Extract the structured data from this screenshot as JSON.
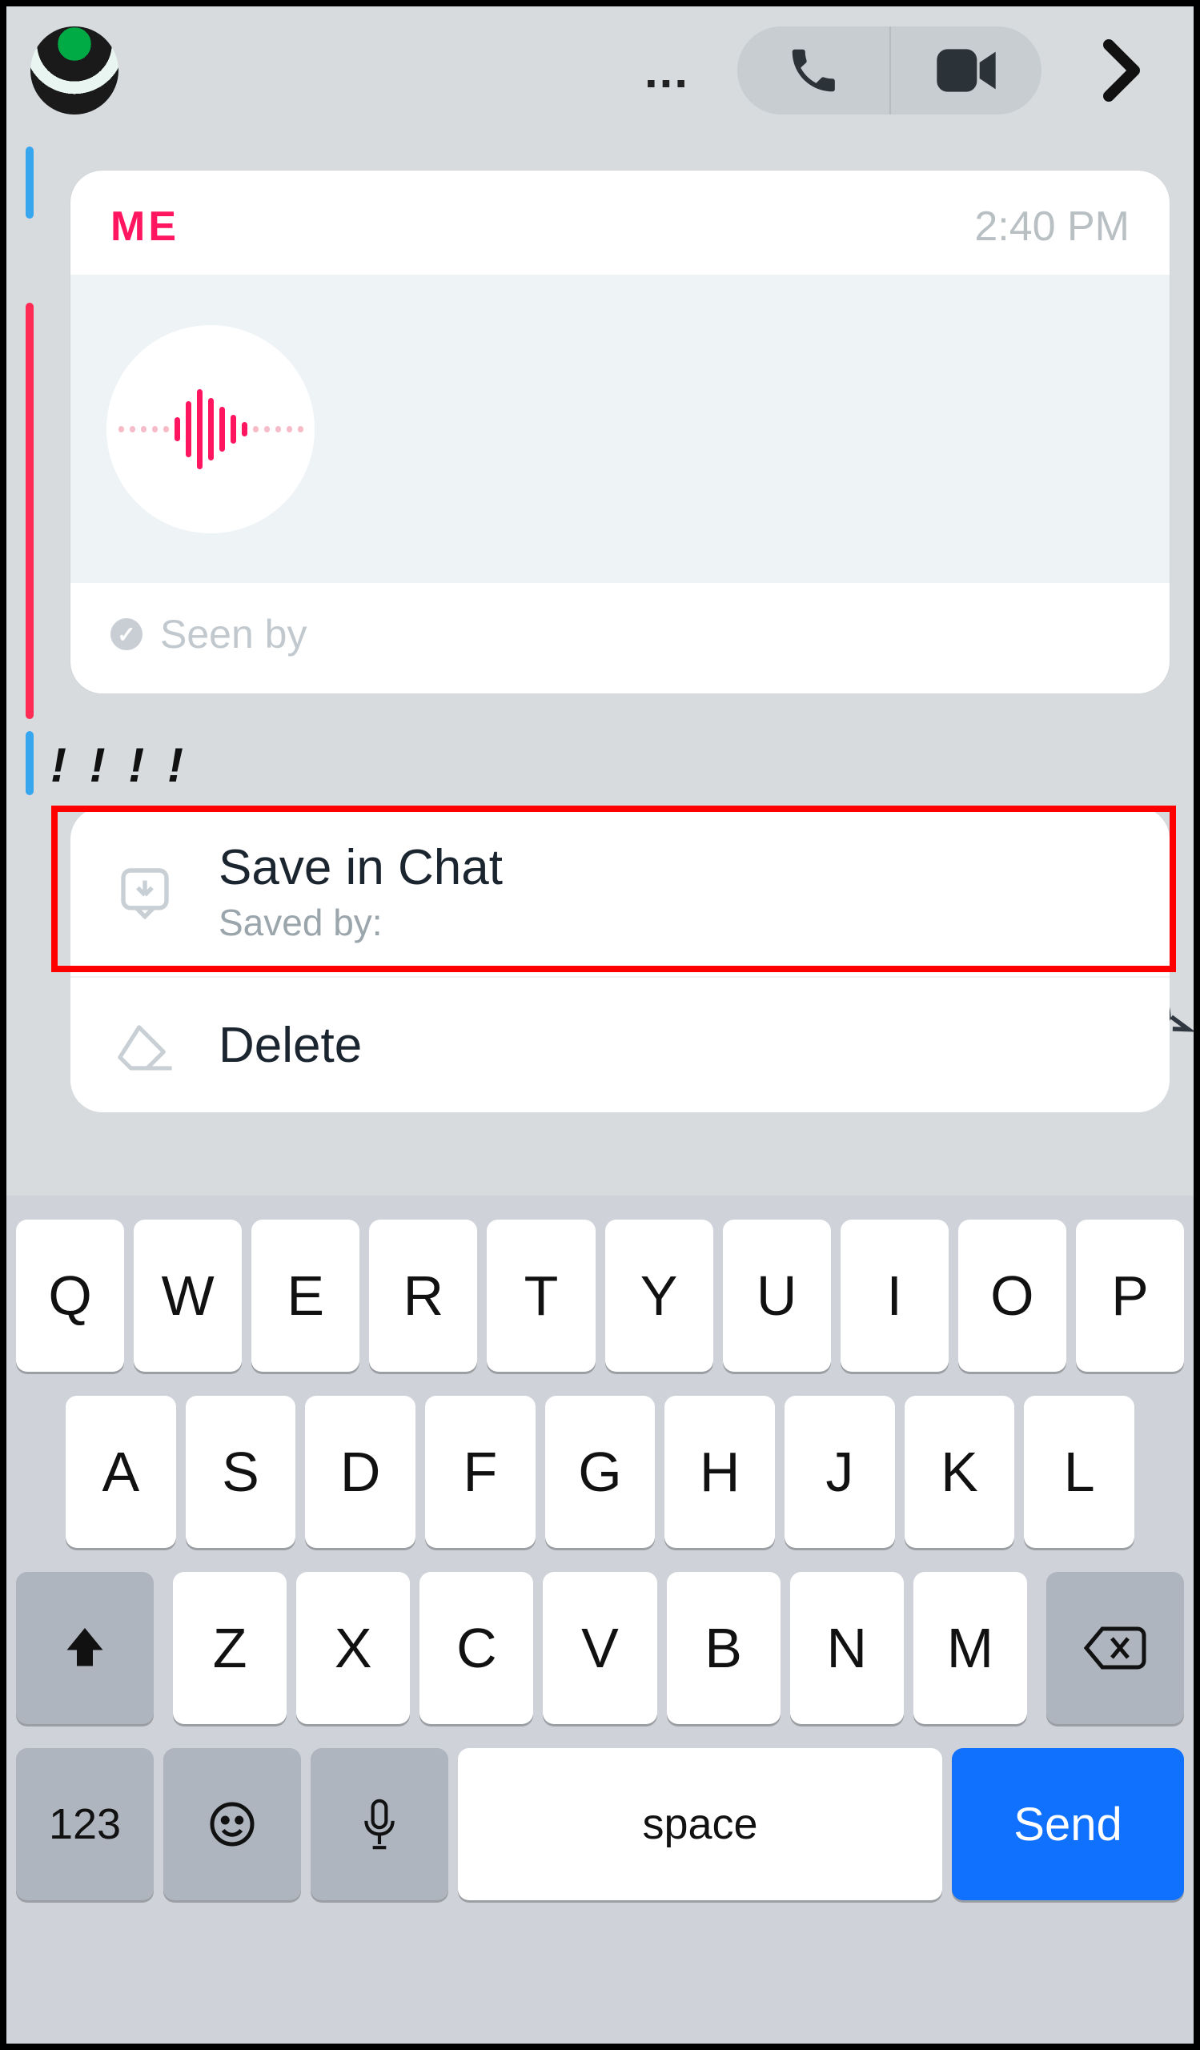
{
  "header": {
    "ellipsis": "...",
    "call_label": "voice-call",
    "video_label": "video-call"
  },
  "background": {
    "peek_text": "! ! ! !"
  },
  "message": {
    "sender": "ME",
    "time": "2:40 PM",
    "seen_label": "Seen by"
  },
  "context_menu": {
    "save": {
      "title": "Save in Chat",
      "subtitle": "Saved by:"
    },
    "delete": {
      "title": "Delete"
    }
  },
  "keyboard": {
    "row1": [
      "Q",
      "W",
      "E",
      "R",
      "T",
      "Y",
      "U",
      "I",
      "O",
      "P"
    ],
    "row2": [
      "A",
      "S",
      "D",
      "F",
      "G",
      "H",
      "J",
      "K",
      "L"
    ],
    "row3": [
      "Z",
      "X",
      "C",
      "V",
      "B",
      "N",
      "M"
    ],
    "numbers_label": "123",
    "space_label": "space",
    "send_label": "Send"
  }
}
